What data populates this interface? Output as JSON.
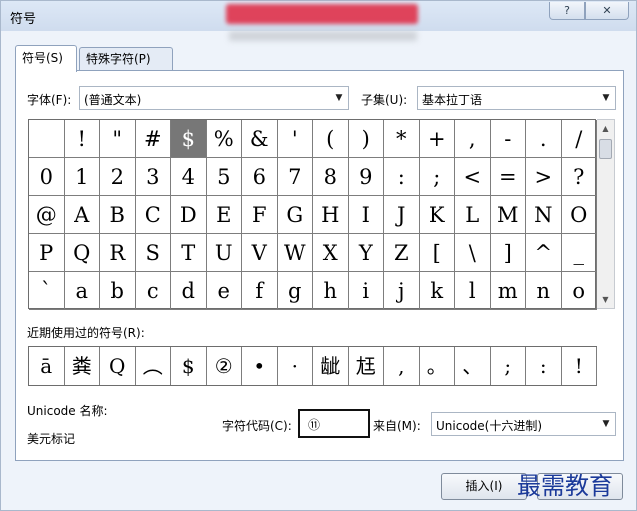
{
  "window": {
    "title": "符号",
    "help_button": "?",
    "close_button": "✕"
  },
  "tabs": [
    {
      "label": "符号(S)"
    },
    {
      "label": "特殊字符(P)"
    }
  ],
  "font": {
    "label": "字体(F):",
    "value": "(普通文本)"
  },
  "subset": {
    "label": "子集(U):",
    "value": "基本拉丁语"
  },
  "symbol_grid": {
    "rows": [
      [
        " ",
        "!",
        "\"",
        "#",
        "$",
        "%",
        "&",
        "'",
        "(",
        ")",
        "*",
        "+",
        ",",
        "-",
        ".",
        "/"
      ],
      [
        "0",
        "1",
        "2",
        "3",
        "4",
        "5",
        "6",
        "7",
        "8",
        "9",
        ":",
        ";",
        "<",
        "=",
        ">",
        "?"
      ],
      [
        "@",
        "A",
        "B",
        "C",
        "D",
        "E",
        "F",
        "G",
        "H",
        "I",
        "J",
        "K",
        "L",
        "M",
        "N",
        "O"
      ],
      [
        "P",
        "Q",
        "R",
        "S",
        "T",
        "U",
        "V",
        "W",
        "X",
        "Y",
        "Z",
        "[",
        "\\",
        "]",
        "^",
        "_"
      ],
      [
        "`",
        "a",
        "b",
        "c",
        "d",
        "e",
        "f",
        "g",
        "h",
        "i",
        "j",
        "k",
        "l",
        "m",
        "n",
        "o"
      ]
    ],
    "selected": "$"
  },
  "recent": {
    "label": "近期使用过的符号(R):",
    "items": [
      "ā",
      "粪",
      "Q",
      "︵",
      "$",
      "②",
      "•",
      "·",
      "龇",
      "尪",
      ",",
      "。",
      "、",
      ";",
      ":",
      "!"
    ]
  },
  "unicode_name": {
    "label": "Unicode 名称:",
    "value": "美元标记"
  },
  "char_code": {
    "label": "字符代码(C):",
    "value": "⑪"
  },
  "from": {
    "label": "来自(M):",
    "value": "Unicode(十六进制)"
  },
  "buttons": {
    "insert": "插入(I)"
  },
  "watermark": "最需教育"
}
